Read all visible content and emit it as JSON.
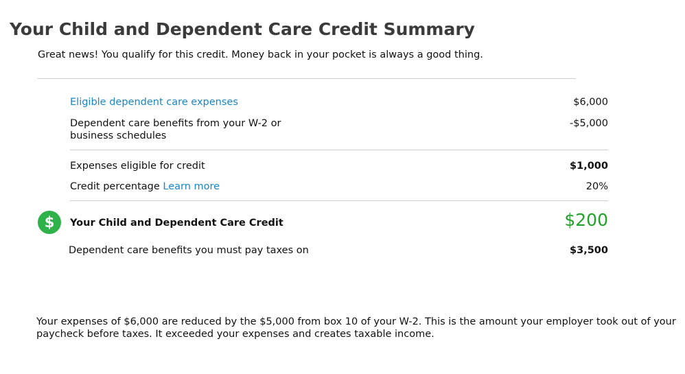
{
  "title": "Your Child and Dependent Care Credit Summary",
  "intro": "Great news! You qualify for this credit. Money back in your pocket is always a good thing.",
  "rows": {
    "eligible_expenses": {
      "label": "Eligible dependent care expenses",
      "value": "$6,000"
    },
    "w2_benefits": {
      "label": "Dependent care benefits from your W-2 or business schedules",
      "value": "-$5,000"
    },
    "expenses_for_credit": {
      "label": "Expenses eligible for credit",
      "value": "$1,000"
    },
    "credit_percentage": {
      "label": "Credit percentage",
      "link": "Learn more",
      "value": "20%"
    },
    "credit": {
      "label": "Your Child and Dependent Care Credit",
      "value": "$200"
    },
    "taxable_benefits": {
      "label": "Dependent care benefits you must pay taxes on",
      "value": "$3,500"
    }
  },
  "icon": {
    "name": "dollar-circle-icon",
    "glyph": "$",
    "color": "#2fb24a"
  },
  "footer": "Your expenses of $6,000 are reduced by the $5,000 from box 10 of your W-2. This is the amount your employer took out of your paycheck before taxes. It exceeded your expenses and creates taxable income.",
  "colors": {
    "link": "#1a86c8",
    "credit": "#21a32a"
  }
}
